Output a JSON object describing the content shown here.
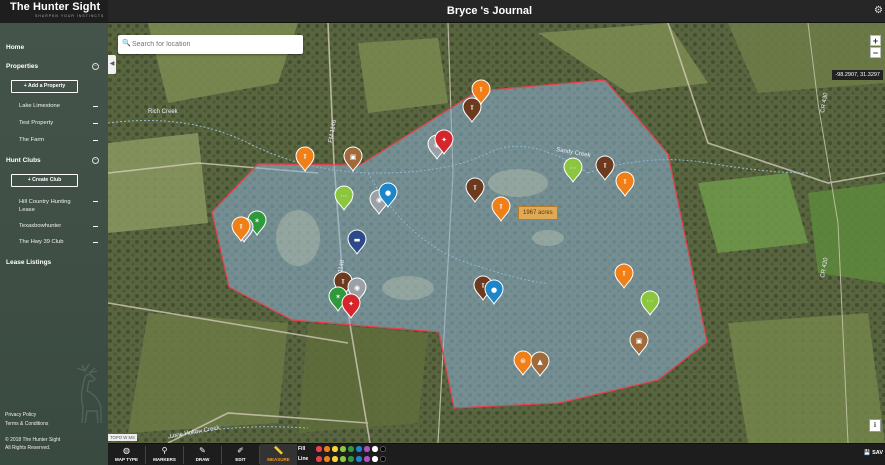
{
  "app": {
    "brand": "The Hunter Sight",
    "tagline": "SHARPEN YOUR INSTINCTS",
    "title": "Bryce 's Journal"
  },
  "sidebar": {
    "home": "Home",
    "properties": {
      "label": "Properties",
      "add_button": "+ Add a Property",
      "items": [
        "Lake Limestone",
        "Test Property",
        "The Farm"
      ]
    },
    "hunt_clubs": {
      "label": "Hunt Clubs",
      "create_button": "+ Create Club",
      "items": [
        "Hill Country Hunting Lease",
        "Texasbowhunter",
        "The Hwy 39 Club"
      ]
    },
    "lease_listings": "Lease Listings",
    "footer": {
      "privacy": "Privacy Policy",
      "terms": "Terms & Conditions",
      "copyright": "© 2018 The Hunter Sight",
      "rights": "All Rights Reserved."
    }
  },
  "map": {
    "search_placeholder": "Search for location",
    "coords": "-98.2907, 31.3297",
    "acreage": "1967 acres",
    "layer_label": "TOPO W MS",
    "zoom_in": "+",
    "zoom_out": "−",
    "info": "i",
    "road_labels": [
      "FM 1146",
      "FM 1146",
      "Rich Creek",
      "Lone Hollow Creek",
      "CR 420",
      "CR 430",
      "Sandy Creek"
    ],
    "colors": {
      "boundary": "#e8414f",
      "fill": "#8ab0d6",
      "orange": "#f07f17",
      "brown": "#6b3a1f",
      "green": "#2e9a3b",
      "lime": "#8cc63f",
      "blue": "#1d86c9",
      "gray": "#9aa0a6",
      "red": "#d6262b",
      "navy": "#2c4a8a",
      "tan": "#a26a3a"
    },
    "pins": [
      {
        "color": "orange",
        "icon": "treestand-icon"
      },
      {
        "color": "brown",
        "icon": "treestand-icon"
      },
      {
        "color": "gray",
        "icon": "camera-icon"
      },
      {
        "color": "red",
        "icon": "kill-icon"
      },
      {
        "color": "orange",
        "icon": "treestand-icon"
      },
      {
        "color": "tan",
        "icon": "feeder-icon"
      },
      {
        "color": "lime",
        "icon": "tracks-icon"
      },
      {
        "color": "gray",
        "icon": "camera-icon"
      },
      {
        "color": "blue",
        "icon": "water-icon"
      },
      {
        "color": "lime",
        "icon": "tracks-icon"
      },
      {
        "color": "brown",
        "icon": "treestand-icon"
      },
      {
        "color": "orange",
        "icon": "treestand-icon"
      },
      {
        "color": "brown",
        "icon": "treestand-icon"
      },
      {
        "color": "orange",
        "icon": "treestand-icon"
      },
      {
        "color": "green",
        "icon": "rub-icon"
      },
      {
        "color": "gray",
        "icon": "camera-icon"
      },
      {
        "color": "orange",
        "icon": "treestand-icon"
      },
      {
        "color": "navy",
        "icon": "blind-icon"
      },
      {
        "color": "brown",
        "icon": "treestand-icon"
      },
      {
        "color": "green",
        "icon": "rub-icon"
      },
      {
        "color": "gray",
        "icon": "camera-icon"
      },
      {
        "color": "red",
        "icon": "kill-icon"
      },
      {
        "color": "brown",
        "icon": "treestand-icon"
      },
      {
        "color": "blue",
        "icon": "water-icon"
      },
      {
        "color": "orange",
        "icon": "treestand-icon"
      },
      {
        "color": "lime",
        "icon": "tracks-icon"
      },
      {
        "color": "tan",
        "icon": "feeder-icon"
      },
      {
        "color": "orange",
        "icon": "atv-icon"
      },
      {
        "color": "tan",
        "icon": "camp-icon"
      }
    ]
  },
  "toolbar": {
    "tools": [
      {
        "label": "MAP TYPE",
        "icon": "globe-icon",
        "active": false
      },
      {
        "label": "MARKERS",
        "icon": "marker-icon",
        "active": false
      },
      {
        "label": "DRAW",
        "icon": "pencil-icon",
        "active": false
      },
      {
        "label": "EDIT",
        "icon": "edit-icon",
        "active": false
      },
      {
        "label": "MEASURE",
        "icon": "ruler-icon",
        "active": true
      }
    ],
    "fill_label": "Fill",
    "line_label": "Line",
    "swatches": [
      "#e8414f",
      "#f07f17",
      "#f5d33a",
      "#8cc63f",
      "#2e9a3b",
      "#1d86c9",
      "#b04fc4",
      "#ffffff",
      "#000000"
    ],
    "save_label": "SAV"
  }
}
